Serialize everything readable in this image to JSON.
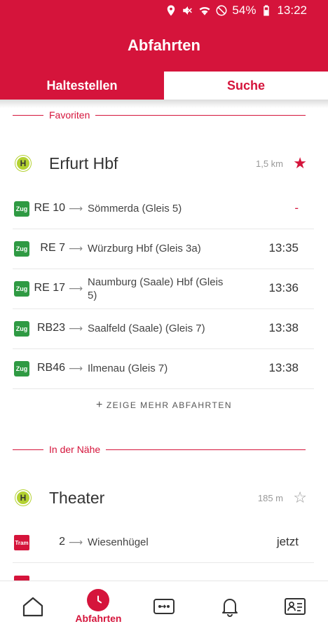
{
  "status_bar": {
    "battery": "54%",
    "time": "13:22",
    "icons": [
      "location-icon",
      "mute-icon",
      "wifi-icon",
      "dnd-icon",
      "battery-icon"
    ]
  },
  "header": {
    "title": "Abfahrten",
    "tabs": [
      {
        "label": "Haltestellen",
        "active": false
      },
      {
        "label": "Suche",
        "active": true
      }
    ]
  },
  "favorites": {
    "section_label": "Favoriten",
    "stop": {
      "name": "Erfurt Hbf",
      "distance": "1,5 km",
      "icon": "H",
      "favorite": true
    },
    "departures": [
      {
        "badge": "Zug",
        "line": "RE 10",
        "destination": "Sömmerda (Gleis 5)",
        "time": "-"
      },
      {
        "badge": "Zug",
        "line": "RE 7",
        "destination": "Würzburg Hbf (Gleis 3a)",
        "time": "13:35"
      },
      {
        "badge": "Zug",
        "line": "RE 17",
        "destination": "Naumburg (Saale) Hbf (Gleis 5)",
        "time": "13:36"
      },
      {
        "badge": "Zug",
        "line": "RB23",
        "destination": "Saalfeld (Saale) (Gleis 7)",
        "time": "13:38"
      },
      {
        "badge": "Zug",
        "line": "RB46",
        "destination": "Ilmenau (Gleis 7)",
        "time": "13:38"
      }
    ],
    "more_label": "ZEIGE MEHR ABFAHRTEN"
  },
  "nearby": {
    "section_label": "In der Nähe",
    "stop": {
      "name": "Theater",
      "distance": "185 m",
      "icon": "H",
      "favorite": false
    },
    "departures": [
      {
        "badge": "Tram",
        "line": "2",
        "destination": "Wiesenhügel",
        "time": "jetzt"
      }
    ]
  },
  "bottom_nav": {
    "items": [
      {
        "name": "home",
        "label": ""
      },
      {
        "name": "departures",
        "label": "Abfahrten",
        "active": true
      },
      {
        "name": "tickets",
        "label": ""
      },
      {
        "name": "alerts",
        "label": ""
      },
      {
        "name": "profile",
        "label": ""
      }
    ]
  },
  "colors": {
    "brand": "#d5143b",
    "train_badge": "#2f9a43",
    "stop_icon": "#b3d130"
  }
}
